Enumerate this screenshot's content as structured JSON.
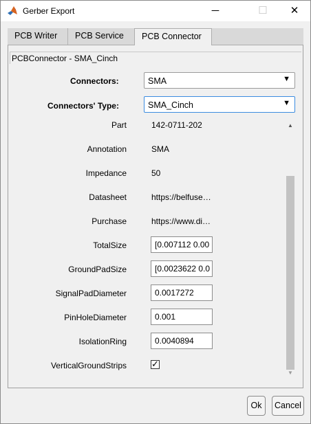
{
  "window": {
    "title": "Gerber Export",
    "icons": {
      "app": "matlab-logo-icon",
      "minimize": "minimize-icon",
      "maximize": "maximize-icon",
      "close": "close-icon"
    }
  },
  "tabs": [
    {
      "label": "PCB Writer",
      "active": false
    },
    {
      "label": "PCB Service",
      "active": false
    },
    {
      "label": "PCB Connector",
      "active": true
    }
  ],
  "panel": {
    "title": "PCBConnector - SMA_Cinch",
    "connectors_label": "Connectors:",
    "connectors_value": "SMA",
    "type_label": "Connectors' Type:",
    "type_value": "SMA_Cinch"
  },
  "properties": [
    {
      "label": "Part",
      "value": "142-0711-202",
      "kind": "text"
    },
    {
      "label": "Annotation",
      "value": "SMA",
      "kind": "text"
    },
    {
      "label": "Impedance",
      "value": "50",
      "kind": "text"
    },
    {
      "label": "Datasheet",
      "value": "https://belfuse…",
      "kind": "text"
    },
    {
      "label": "Purchase",
      "value": "https://www.di…",
      "kind": "text"
    },
    {
      "label": "TotalSize",
      "value": "[0.007112 0.00",
      "kind": "input"
    },
    {
      "label": "GroundPadSize",
      "value": "[0.0023622 0.0",
      "kind": "input"
    },
    {
      "label": "SignalPadDiameter",
      "value": "0.0017272",
      "kind": "input"
    },
    {
      "label": "PinHoleDiameter",
      "value": "0.001",
      "kind": "input"
    },
    {
      "label": "IsolationRing",
      "value": "0.0040894",
      "kind": "input"
    },
    {
      "label": "VerticalGroundStrips",
      "checked": true,
      "kind": "checkbox"
    }
  ],
  "buttons": {
    "ok": "Ok",
    "cancel": "Cancel"
  },
  "glyphs": {
    "dropdown_arrow": "▼",
    "check": "✓",
    "scroll_up": "▲",
    "scroll_down": "▼",
    "minimize": "─",
    "maximize": "☐",
    "close": "✕"
  }
}
